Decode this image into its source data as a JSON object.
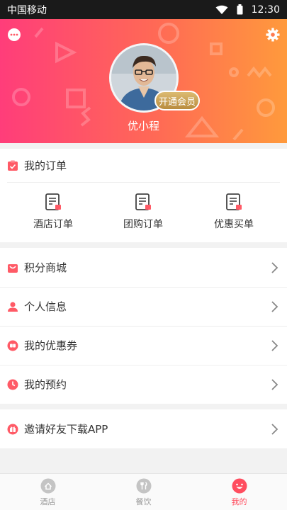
{
  "status_bar": {
    "carrier": "中国移动",
    "time": "12:30"
  },
  "profile": {
    "username": "优小程",
    "vip_button": "开通会员"
  },
  "orders": {
    "title": "我的订单",
    "items": [
      {
        "label": "酒店订单",
        "icon": "hotel-order-icon"
      },
      {
        "label": "团购订单",
        "icon": "group-order-icon"
      },
      {
        "label": "优惠买单",
        "icon": "discount-pay-icon"
      }
    ]
  },
  "menu": [
    {
      "label": "积分商城",
      "icon": "mall-icon"
    },
    {
      "label": "个人信息",
      "icon": "user-icon"
    },
    {
      "label": "我的优惠券",
      "icon": "coupon-icon"
    },
    {
      "label": "我的预约",
      "icon": "clock-icon"
    }
  ],
  "invite": {
    "label": "邀请好友下载APP",
    "icon": "gift-icon"
  },
  "tabs": [
    {
      "label": "酒店",
      "icon": "hotel-tab-icon"
    },
    {
      "label": "餐饮",
      "icon": "dining-tab-icon"
    },
    {
      "label": "我的",
      "icon": "mine-tab-icon",
      "active": true
    }
  ],
  "colors": {
    "accent": "#ff4d5f",
    "header_start": "#ff3d7a",
    "header_end": "#ff9a3c",
    "vip_gold": "#c9a24e"
  }
}
